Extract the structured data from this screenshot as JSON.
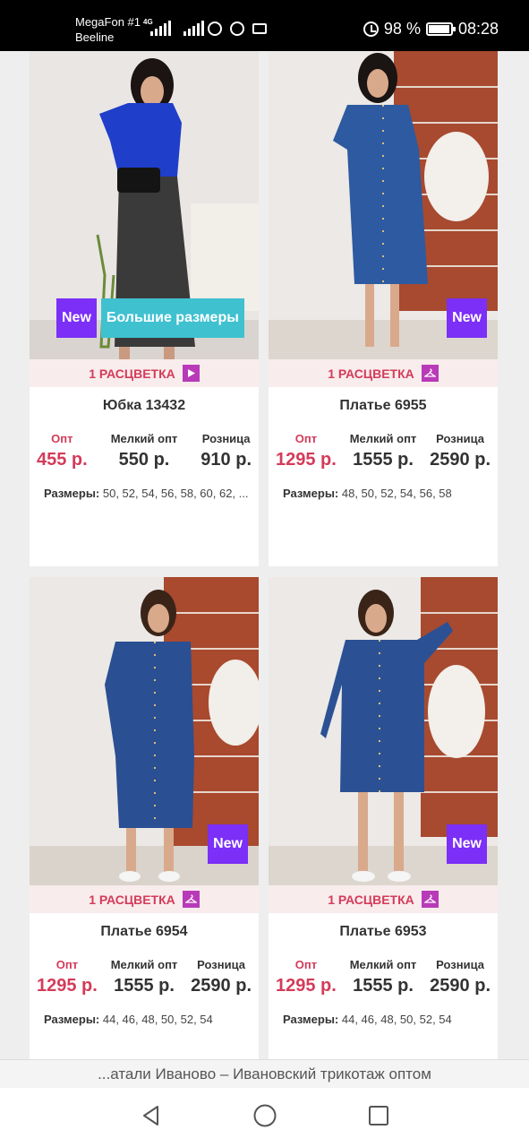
{
  "status_bar": {
    "carrier1": "MegaFon #1",
    "carrier2": "Beeline",
    "network": "4G",
    "battery_percent": "98 %",
    "battery_level": 0.98,
    "time": "08:28"
  },
  "products": [
    {
      "title": "Юбка 13432",
      "colorway_label": "1 РАСЦВЕТКА",
      "colorway_icon": "play-icon",
      "badges": [
        "New",
        "Большие размеры"
      ],
      "price_labels": [
        "Опт",
        "Мелкий опт",
        "Розница"
      ],
      "prices": [
        "455 р.",
        "550 р.",
        "910 р."
      ],
      "sizes_label": "Размеры:",
      "sizes": "50, 52, 54, 56, 58, 60, 62, ..."
    },
    {
      "title": "Платье 6955",
      "colorway_label": "1 РАСЦВЕТКА",
      "colorway_icon": "hanger-icon",
      "badges": [
        "New"
      ],
      "price_labels": [
        "Опт",
        "Мелкий опт",
        "Розница"
      ],
      "prices": [
        "1295 р.",
        "1555 р.",
        "2590 р."
      ],
      "sizes_label": "Размеры:",
      "sizes": "48, 50, 52, 54, 56, 58"
    },
    {
      "title": "Платье 6954",
      "colorway_label": "1 РАСЦВЕТКА",
      "colorway_icon": "hanger-icon",
      "badges": [
        "New"
      ],
      "price_labels": [
        "Опт",
        "Мелкий опт",
        "Розница"
      ],
      "prices": [
        "1295 р.",
        "1555 р.",
        "2590 р."
      ],
      "sizes_label": "Размеры:",
      "sizes": "44, 46, 48, 50, 52, 54"
    },
    {
      "title": "Платье 6953",
      "colorway_label": "1 РАСЦВЕТКА",
      "colorway_icon": "hanger-icon",
      "badges": [
        "New"
      ],
      "price_labels": [
        "Опт",
        "Мелкий опт",
        "Розница"
      ],
      "prices": [
        "1295 р.",
        "1555 р.",
        "2590 р."
      ],
      "sizes_label": "Размеры:",
      "sizes": "44, 46, 48, 50, 52, 54"
    }
  ],
  "url_bar": {
    "title": "...атали Иваново – Ивановский трикотаж оптом"
  },
  "nav_bar": {
    "back": "back-icon",
    "home": "home-icon",
    "recents": "recents-icon"
  },
  "colors": {
    "accent": "#d43b5a",
    "new_badge": "#7b2ff7",
    "size_badge": "#3fc1d0",
    "colorway_icon": "#b83ab8"
  }
}
